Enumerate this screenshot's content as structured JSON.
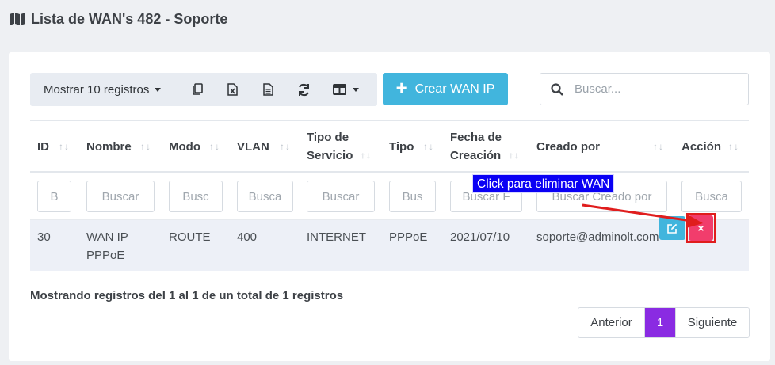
{
  "page": {
    "title": "Lista de WAN's 482 - Soporte"
  },
  "toolbar": {
    "show_label": "Mostrar 10 registros",
    "icons": [
      "copy-icon",
      "excel-icon",
      "csv-icon",
      "refresh-icon",
      "columns-icon"
    ]
  },
  "create_button": {
    "label": "Crear WAN IP"
  },
  "search": {
    "placeholder": "Buscar..."
  },
  "table": {
    "headers": [
      {
        "line1": "ID",
        "line2": ""
      },
      {
        "line1": "Nombre",
        "line2": ""
      },
      {
        "line1": "Modo",
        "line2": ""
      },
      {
        "line1": "VLAN",
        "line2": ""
      },
      {
        "line1": "Tipo de",
        "line2": "Servicio"
      },
      {
        "line1": "Tipo",
        "line2": ""
      },
      {
        "line1": "Fecha de",
        "line2": "Creación"
      },
      {
        "line1": "Creado por",
        "line2": ""
      },
      {
        "line1": "Acción",
        "line2": ""
      }
    ],
    "sort_glyph": "↑↓",
    "filters": [
      "B",
      "Buscar",
      "Busc",
      "Busca",
      "Buscar",
      "Bus",
      "Buscar F",
      "Buscar Creado por",
      "Busca"
    ],
    "rows": [
      {
        "id": "30",
        "nombre_line1": "WAN IP",
        "nombre_line2": "PPPoE",
        "modo": "ROUTE",
        "vlan": "400",
        "tipo_servicio": "INTERNET",
        "tipo": "PPPoE",
        "fecha": "2021/07/10",
        "creado_por": "soporte@adminolt.com"
      }
    ],
    "delete_glyph": "×"
  },
  "annotation": {
    "text": "Click para eliminar WAN",
    "color": "#0a00f4",
    "arrow_color": "#e01d1d"
  },
  "footer": {
    "info": "Mostrando registros del 1 al 1 de un total de 1 registros"
  },
  "pagination": {
    "prev": "Anterior",
    "current": "1",
    "next": "Siguiente",
    "active_color": "#8a2be2"
  },
  "colors": {
    "primary": "#41b5dd",
    "danger": "#f13d6c",
    "row_highlight": "#edf0f7"
  }
}
